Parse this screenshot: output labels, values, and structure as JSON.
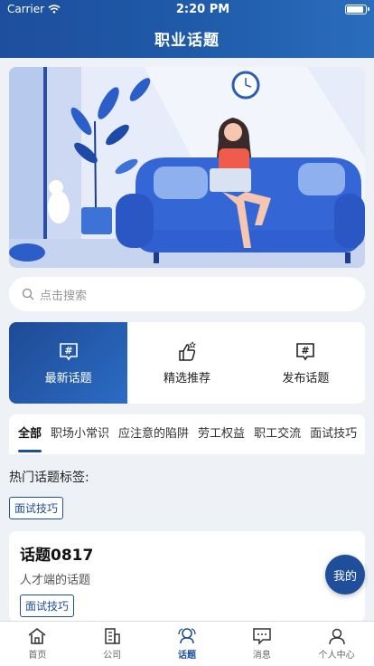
{
  "status": {
    "carrier": "Carrier",
    "time": "2:20 PM"
  },
  "header": {
    "title": "职业话题"
  },
  "search": {
    "placeholder": "点击搜索"
  },
  "features": [
    {
      "label": "最新话题",
      "icon": "hashtag-chat-icon",
      "active": true
    },
    {
      "label": "精选推荐",
      "icon": "thumbs-up-icon",
      "active": false
    },
    {
      "label": "发布话题",
      "icon": "hashtag-chat-icon",
      "active": false
    }
  ],
  "category_tabs": [
    "全部",
    "职场小常识",
    "应注意的陷阱",
    "劳工权益",
    "职工交流",
    "面试技巧"
  ],
  "hot": {
    "label": "热门话题标签:",
    "tag": "面试技巧"
  },
  "topic": {
    "title": "话题0817",
    "subtitle": "人才端的话题",
    "tag": "面试技巧"
  },
  "fab": {
    "label": "我的"
  },
  "tabbar": [
    {
      "label": "首页",
      "icon": "home-icon"
    },
    {
      "label": "公司",
      "icon": "building-icon"
    },
    {
      "label": "话题",
      "icon": "topic-icon",
      "active": true
    },
    {
      "label": "消息",
      "icon": "message-icon"
    },
    {
      "label": "个人中心",
      "icon": "user-icon"
    }
  ],
  "colors": {
    "primary": "#1f4e9a",
    "background": "#eef1f6"
  }
}
